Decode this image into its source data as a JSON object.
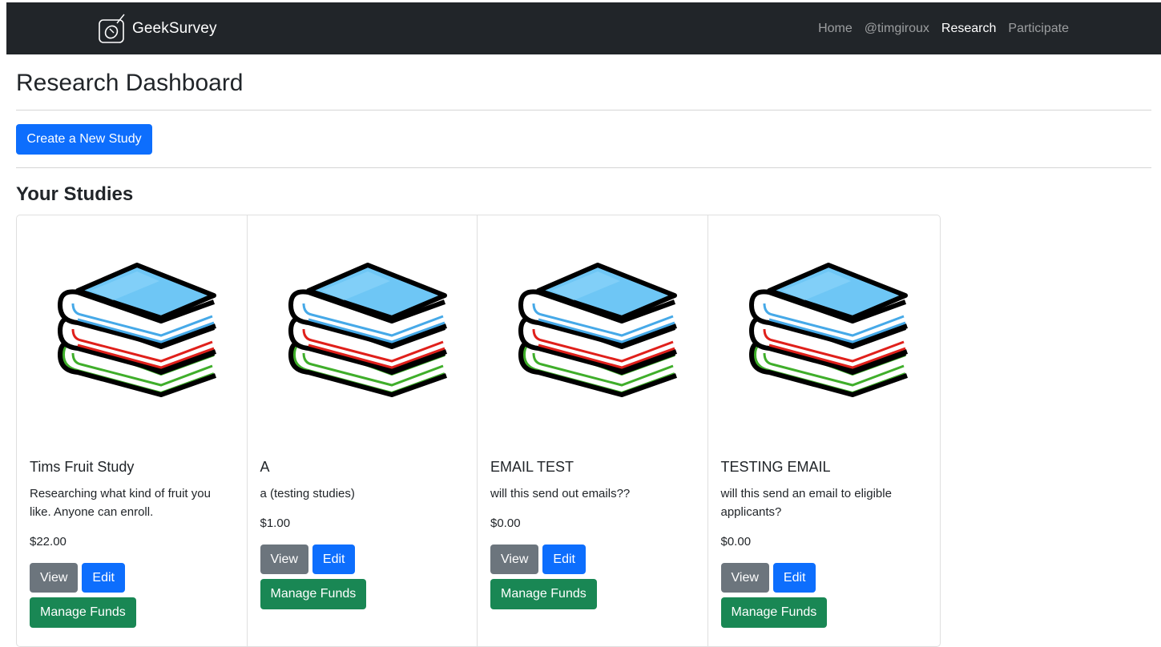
{
  "navbar": {
    "brand": "GeekSurvey",
    "brand_icon": "mouse-icon",
    "links": [
      {
        "label": "Home",
        "active": false
      },
      {
        "label": "@timgiroux",
        "active": false
      },
      {
        "label": "Research",
        "active": true
      },
      {
        "label": "Participate",
        "active": false
      }
    ]
  },
  "page": {
    "title": "Research Dashboard",
    "create_button": "Create a New Study",
    "section_title": "Your Studies"
  },
  "studies": [
    {
      "image_icon": "books-stack-icon",
      "title": "Tims Fruit Study",
      "description": "Researching what kind of fruit you like. Anyone can enroll.",
      "price": "$22.00",
      "view_label": "View",
      "edit_label": "Edit",
      "funds_label": "Manage Funds"
    },
    {
      "image_icon": "books-stack-icon",
      "title": "A",
      "description": "a (testing studies)",
      "price": "$1.00",
      "view_label": "View",
      "edit_label": "Edit",
      "funds_label": "Manage Funds"
    },
    {
      "image_icon": "books-stack-icon",
      "title": "EMAIL TEST",
      "description": "will this send out emails??",
      "price": "$0.00",
      "view_label": "View",
      "edit_label": "Edit",
      "funds_label": "Manage Funds"
    },
    {
      "image_icon": "books-stack-icon",
      "title": "TESTING EMAIL",
      "description": "will this send an email to eligible applicants?",
      "price": "$0.00",
      "view_label": "View",
      "edit_label": "Edit",
      "funds_label": "Manage Funds"
    }
  ],
  "colors": {
    "navbar_bg": "#212529",
    "primary": "#0d6efd",
    "secondary": "#6c757d",
    "success": "#198754",
    "book_top": "#6ec6f5",
    "book_blue": "#46a9e8",
    "book_red": "#e0201b",
    "book_green": "#3fae2a"
  }
}
